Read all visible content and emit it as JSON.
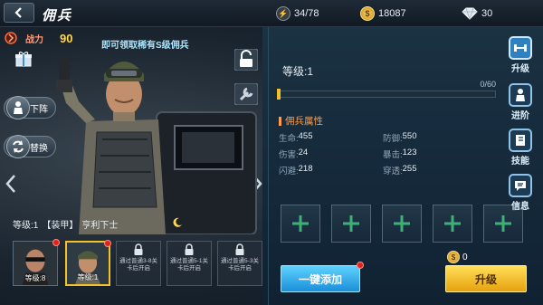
{
  "topbar": {
    "title": "佣兵",
    "stamina": "34/78",
    "gold": "18087",
    "diamond": "30"
  },
  "power": {
    "label": "战力",
    "value": "90"
  },
  "announcement": "即可领取稀有S级佣兵",
  "side_buttons": {
    "download": "下阵",
    "swap": "替换"
  },
  "merc_info": {
    "level": "等级:1",
    "type": "【装甲】",
    "rank": "亨利下士"
  },
  "cards": [
    {
      "label": "等级:8"
    },
    {
      "label": "等级:1"
    },
    {
      "lock_text": "通过普通3-8关卡后开启"
    },
    {
      "lock_text": "通过普通5-1关卡后开启"
    },
    {
      "lock_text": "通过普通5-3关卡后开启"
    }
  ],
  "level_panel": {
    "level": "等级:1",
    "exp": "0/60",
    "exp_fraction": 0
  },
  "attributes": {
    "title": "佣兵属性",
    "rows": [
      [
        {
          "name": "生命:",
          "value": "455"
        },
        {
          "name": "防御:",
          "value": "550"
        }
      ],
      [
        {
          "name": "伤害:",
          "value": "24"
        },
        {
          "name": "暴击:",
          "value": "123"
        }
      ],
      [
        {
          "name": "闪避:",
          "value": "218"
        },
        {
          "name": "穿透:",
          "value": "255"
        }
      ]
    ]
  },
  "upgrade_cost": "0",
  "buttons": {
    "add_all": "一键添加",
    "upgrade": "升级"
  },
  "tabs": [
    {
      "label": "升级"
    },
    {
      "label": "进阶"
    },
    {
      "label": "技能"
    },
    {
      "label": "信息"
    }
  ],
  "colors": {
    "accent_gold": "#f2c12a",
    "accent_blue": "#1a8fd8",
    "attr_title": "#ff9b4a"
  }
}
